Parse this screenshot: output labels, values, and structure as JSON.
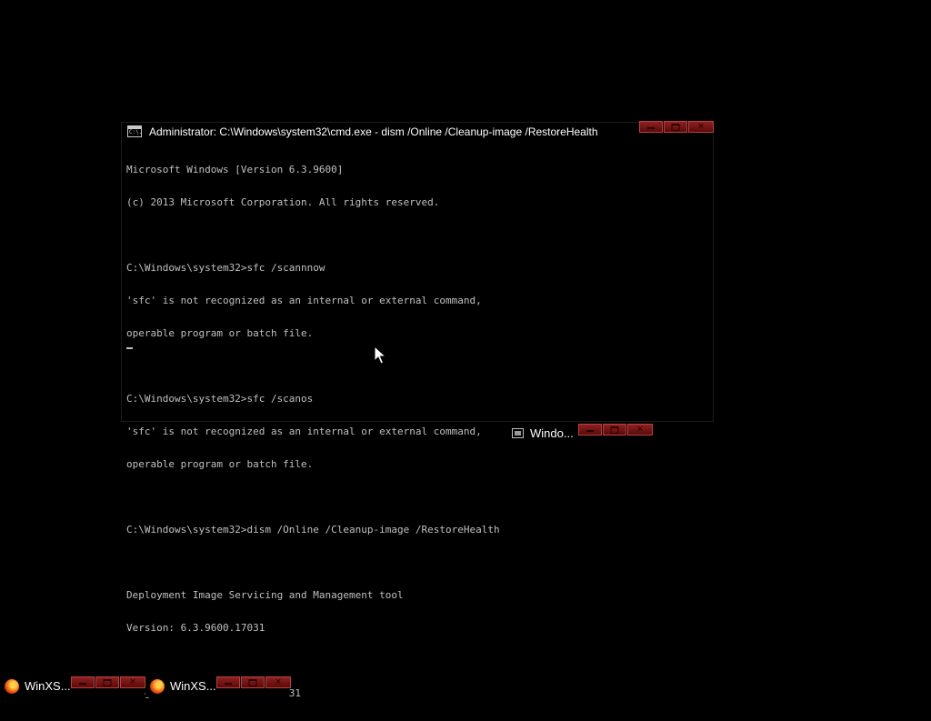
{
  "console_window": {
    "title": "Administrator: C:\\Windows\\system32\\cmd.exe - dism  /Online /Cleanup-image /RestoreHealth",
    "icon": "cmd-icon",
    "icon_text": "C:\\.",
    "lines": [
      "Microsoft Windows [Version 6.3.9600]",
      "(c) 2013 Microsoft Corporation. All rights reserved.",
      "",
      "C:\\Windows\\system32>sfc /scannnow",
      "'sfc' is not recognized as an internal or external command,",
      "operable program or batch file.",
      "",
      "C:\\Windows\\system32>sfc /scanos",
      "'sfc' is not recognized as an internal or external command,",
      "operable program or batch file.",
      "",
      "C:\\Windows\\system32>dism /Online /Cleanup-image /RestoreHealth",
      "",
      "Deployment Image Servicing and Management tool",
      "Version: 6.3.9600.17031",
      "",
      "Image Version: 6.3.9600.17031"
    ]
  },
  "minimized_window": {
    "label": "Windo...",
    "icon": "window-icon"
  },
  "taskbar": {
    "items": [
      {
        "label": "WinXS...",
        "icon": "firefox-icon"
      },
      {
        "label": "WinXS...",
        "icon": "firefox-icon"
      }
    ]
  },
  "colors": {
    "background": "#000000",
    "console_text": "#c0c0c0",
    "caption_button": "#8f2020"
  }
}
